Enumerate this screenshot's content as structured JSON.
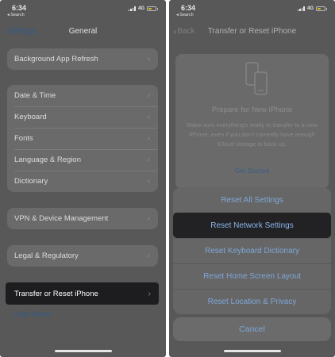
{
  "left": {
    "status": {
      "time": "6:34",
      "back_label": "◂ Search",
      "network": "4G"
    },
    "nav": {
      "back_label": "Settings",
      "title": "General"
    },
    "groups": [
      [
        "Background App Refresh"
      ],
      [
        "Date & Time",
        "Keyboard",
        "Fonts",
        "Language & Region",
        "Dictionary"
      ],
      [
        "VPN & Device Management"
      ],
      [
        "Legal & Regulatory"
      ]
    ],
    "selected_item": "Transfer or Reset iPhone",
    "shut_down": "Shut Down"
  },
  "right": {
    "status": {
      "time": "6:34",
      "back_label": "◂ Search",
      "network": "4G"
    },
    "nav": {
      "back_label": "Back",
      "title": "Transfer or Reset iPhone"
    },
    "prepare": {
      "title": "Prepare for New iPhone",
      "description": "Make sure everything's ready to transfer to a new iPhone, even if you don't currently have enough iCloud storage to back up.",
      "get_started": "Get Started"
    },
    "sheet_options": [
      "Reset All Settings",
      "Reset Network Settings",
      "Reset Keyboard Dictionary",
      "Reset Home Screen Layout",
      "Reset Location & Privacy"
    ],
    "cancel": "Cancel"
  },
  "colors": {
    "accent": "#7ea7d8",
    "dim_overlay": "#585858",
    "highlight": "#222225"
  },
  "icons": [
    "chevron-left-icon",
    "chevron-right-icon",
    "signal-icon",
    "battery-icon",
    "phones-transfer-icon"
  ]
}
